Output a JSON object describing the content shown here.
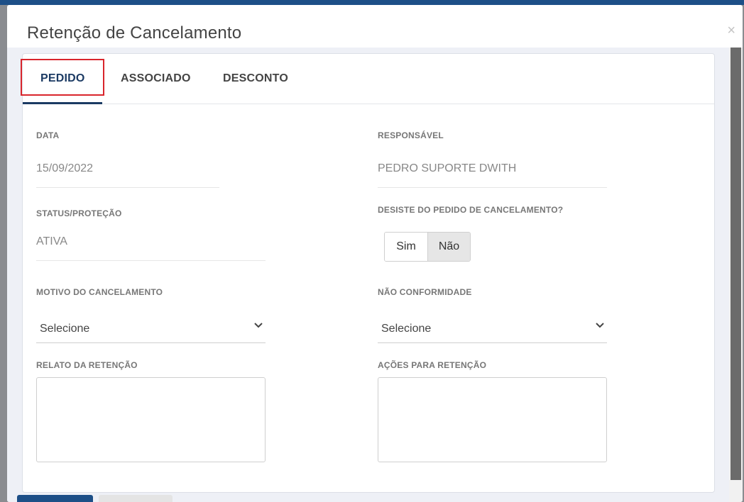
{
  "modal": {
    "title": "Retenção de Cancelamento",
    "close_glyph": "×"
  },
  "tabs": [
    {
      "label": "PEDIDO",
      "active": true
    },
    {
      "label": "ASSOCIADO",
      "active": false
    },
    {
      "label": "DESCONTO",
      "active": false
    }
  ],
  "form": {
    "data": {
      "label": "DATA",
      "value": "15/09/2022"
    },
    "responsavel": {
      "label": "RESPONSÁVEL",
      "value": "PEDRO SUPORTE DWITH"
    },
    "status": {
      "label": "STATUS/PROTEÇÃO",
      "value": "ATIVA"
    },
    "desiste": {
      "label": "DESISTE DO PEDIDO DE CANCELAMENTO?",
      "options": [
        "Sim",
        "Não"
      ],
      "selected": "Não"
    },
    "motivo": {
      "label": "MOTIVO DO CANCELAMENTO",
      "value": "Selecione"
    },
    "nao_conformidade": {
      "label": "NÃO CONFORMIDADE",
      "value": "Selecione"
    },
    "relato": {
      "label": "RELATO DA RETENÇÃO",
      "value": ""
    },
    "acoes": {
      "label": "AÇÕES PARA RETENÇÃO",
      "value": ""
    }
  },
  "colors": {
    "primary": "#1b3a63",
    "highlight": "#d9252c",
    "topbar": "#1d4f87"
  }
}
